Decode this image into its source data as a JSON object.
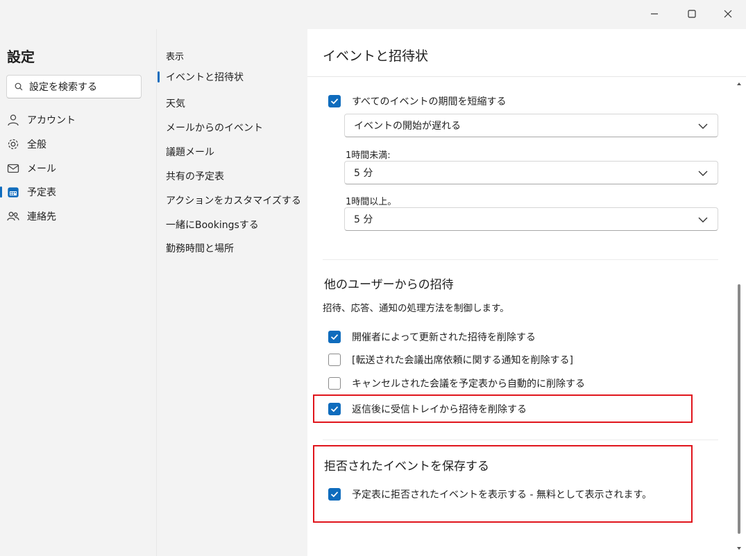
{
  "window": {
    "minimize": "minimize",
    "maximize": "maximize",
    "close": "close"
  },
  "leftnav": {
    "title": "設定",
    "search_placeholder": "設定を検索する",
    "items": [
      {
        "label": "アカウント",
        "icon": "person-icon"
      },
      {
        "label": "全般",
        "icon": "gear-icon"
      },
      {
        "label": "メール",
        "icon": "mail-icon"
      },
      {
        "label": "予定表",
        "icon": "calendar-icon",
        "active": true
      },
      {
        "label": "連絡先",
        "icon": "people-icon"
      }
    ]
  },
  "midnav": {
    "header": "表示",
    "items": [
      {
        "label": "イベントと招待状",
        "active": true
      },
      {
        "label": "天気"
      },
      {
        "label": "メールからのイベント"
      },
      {
        "label": "議題メール"
      },
      {
        "label": "共有の予定表"
      },
      {
        "label": "アクションをカスタマイズする"
      },
      {
        "label": "一緒にBookingsする"
      },
      {
        "label": "勤務時間と場所"
      }
    ]
  },
  "content": {
    "title": "イベントと招待状",
    "shorten": {
      "label": "すべてのイベントの期間を短縮する",
      "checked": true,
      "mode_value": "イベントの開始が遅れる",
      "under_hour_label": "1時間未満:",
      "under_hour_value": "5 分",
      "over_hour_label": "1時間以上。",
      "over_hour_value": "5 分"
    },
    "invites": {
      "title": "他のユーザーからの招待",
      "description": "招待、応答、通知の処理方法を制御します。",
      "options": [
        {
          "label": "開催者によって更新された招待を削除する",
          "checked": true
        },
        {
          "label": "[転送された会議出席依頼に関する通知を削除する]",
          "checked": false
        },
        {
          "label": "キャンセルされた会議を予定表から自動的に削除する",
          "checked": false
        },
        {
          "label": "返信後に受信トレイから招待を削除する",
          "checked": true
        }
      ]
    },
    "declined": {
      "title": "拒否されたイベントを保存する",
      "option_label": "予定表に拒否されたイベントを表示する - 無料として表示されます。",
      "checked": true
    }
  },
  "colors": {
    "accent": "#0f6cbd",
    "highlight": "#e0151c"
  }
}
